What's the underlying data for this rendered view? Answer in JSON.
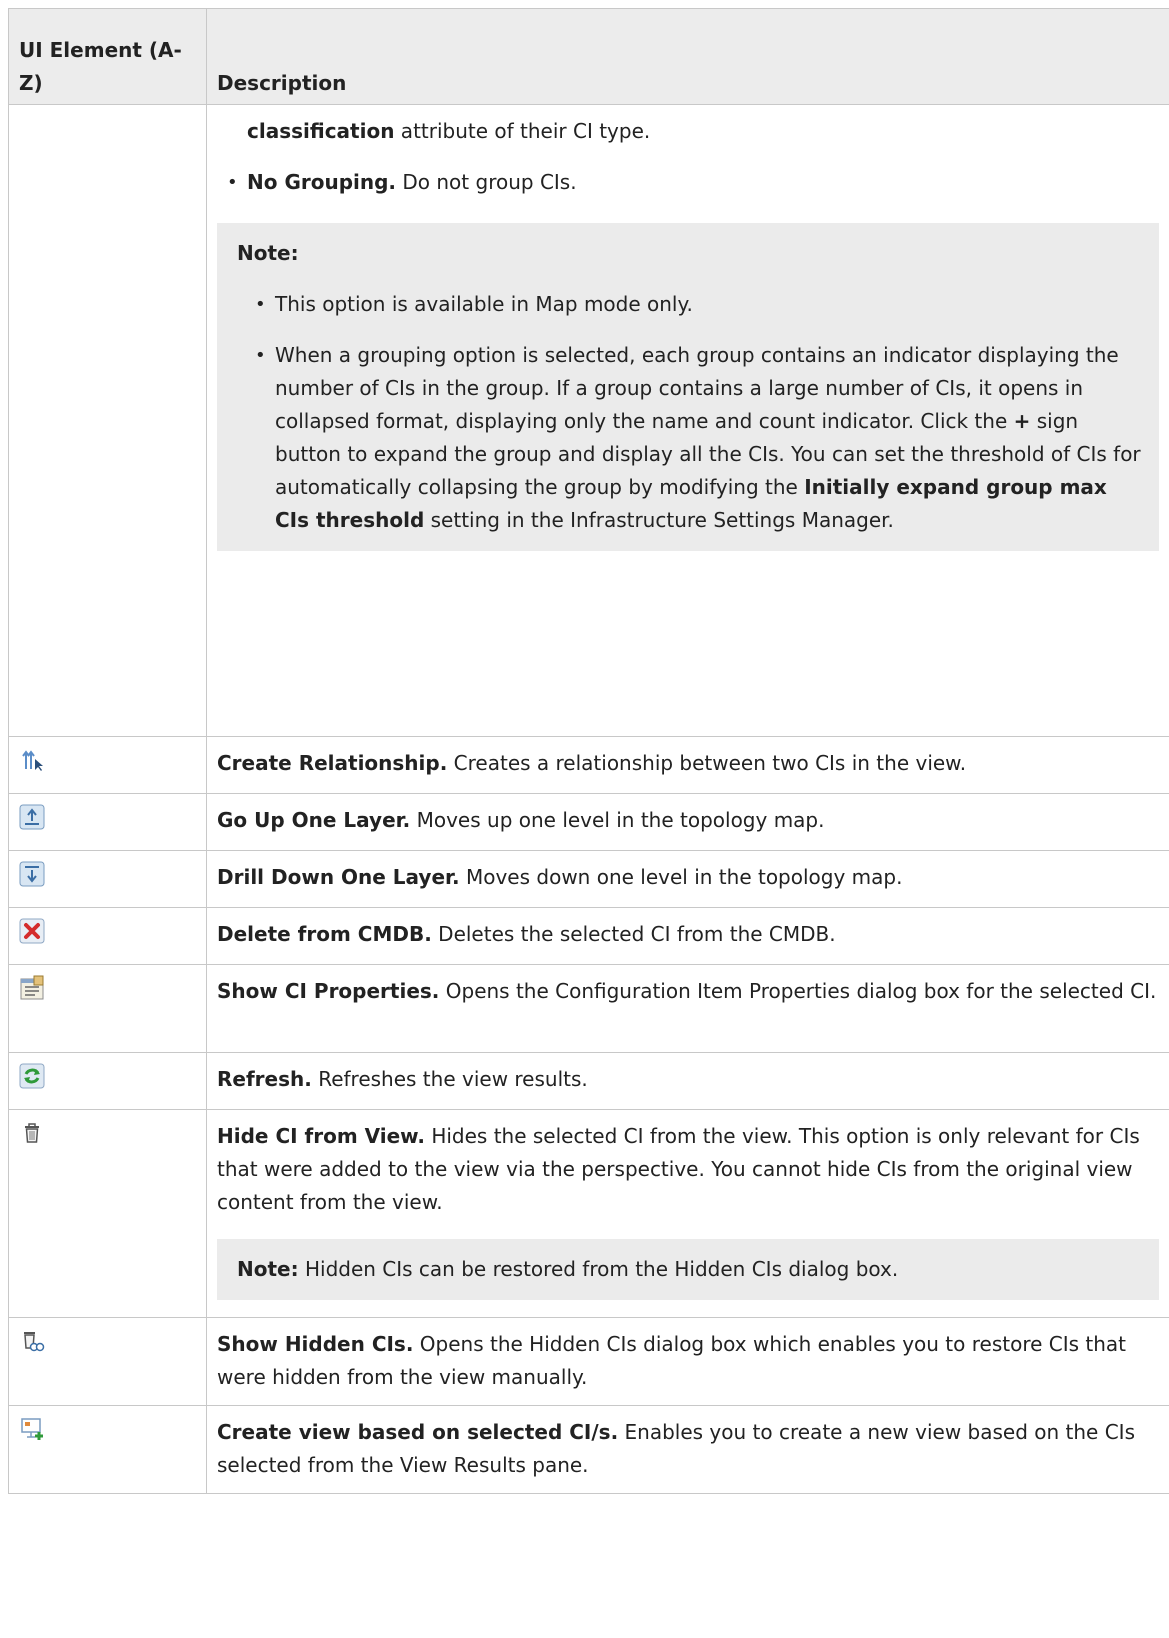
{
  "table": {
    "headers": {
      "col1": "UI Element (A-Z)",
      "col2": "Description"
    },
    "top": {
      "classification_bold": "classification",
      "classification_rest": " attribute of their CI type.",
      "nogroup_bold": "No Grouping.",
      "nogroup_rest": " Do not group CIs.",
      "note_label": "Note:",
      "note_item1": "This option is available in Map mode only.",
      "note_item2_a": "When a grouping option is selected, each group contains an indicator displaying the number of CIs in the group. If a group contains a large number of CIs, it opens in collapsed format, displaying only the name and count indicator. Click the ",
      "note_item2_plus": "+",
      "note_item2_b": " sign button to expand the group and display all the CIs. You can set the threshold of CIs for automatically collapsing the group by modifying the ",
      "note_item2_bold": "Initially expand group max CIs threshold",
      "note_item2_c": " setting in the Infrastructure Settings Manager."
    },
    "rows": [
      {
        "icon": "create-relationship-icon",
        "title": "Create Relationship.",
        "desc": " Creates a relationship between two CIs in the view."
      },
      {
        "icon": "go-up-layer-icon",
        "title": "Go Up One Layer.",
        "desc": " Moves up one level in the topology map."
      },
      {
        "icon": "drill-down-layer-icon",
        "title": "Drill Down One Layer.",
        "desc": " Moves down one level in the topology map."
      },
      {
        "icon": "delete-icon",
        "title": "Delete from CMDB.",
        "desc": " Deletes the selected CI from the CMDB."
      },
      {
        "icon": "properties-icon",
        "title": "Show CI Properties.",
        "desc": " Opens the Configuration Item Properties dialog box for the selected CI."
      },
      {
        "icon": "refresh-icon",
        "title": "Refresh.",
        "desc": " Refreshes the view results."
      },
      {
        "icon": "trash-icon",
        "title": "Hide CI from View.",
        "desc": " Hides the selected CI from the view. This option is only relevant for CIs that were added to the view via the perspective. You cannot hide CIs from the original view content from the view.",
        "note_label": "Note:",
        "note_text": " Hidden CIs can be restored from the Hidden CIs dialog box."
      },
      {
        "icon": "show-hidden-icon",
        "title": "Show Hidden CIs.",
        "desc": " Opens the Hidden CIs dialog box which enables you to restore CIs that were hidden from the view manually."
      },
      {
        "icon": "create-view-icon",
        "title": "Create view based on selected CI/s.",
        "desc": " Enables you to create a new view based on the CIs selected from the View Results pane."
      }
    ]
  }
}
